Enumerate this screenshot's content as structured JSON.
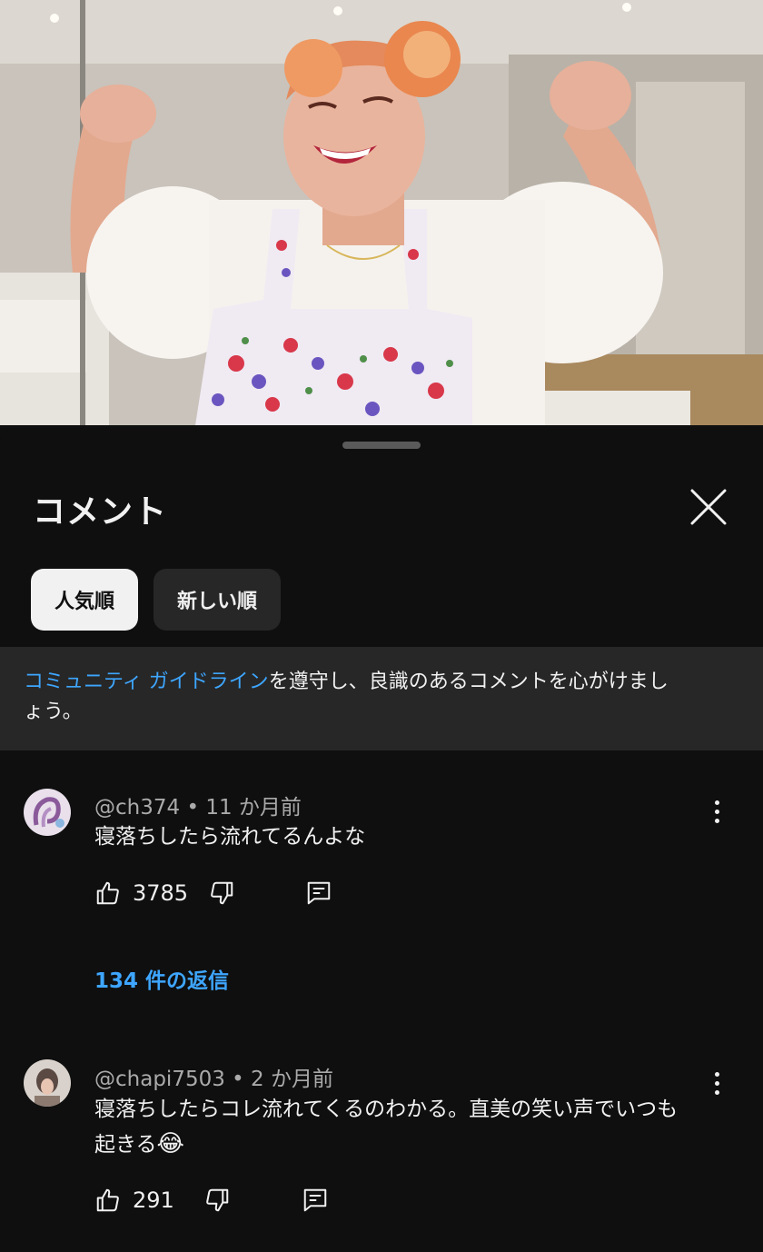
{
  "sheet": {
    "title": "コメント",
    "sort_chips": [
      {
        "label": "人気順",
        "selected": true
      },
      {
        "label": "新しい順",
        "selected": false
      }
    ],
    "notice_link": "コミュニティ ガイドライン",
    "notice_text_line1": "を遵守し、良識のあるコメントを心がけまし",
    "notice_text_line2": "ょう。"
  },
  "comments": [
    {
      "author": "@ch374",
      "time": "11 か月前",
      "text": "寝落ちしたら流れてるんよな",
      "likes": "3785",
      "replies_label": "134 件の返信"
    },
    {
      "author": "@chapi7503",
      "time": "2 か月前",
      "text_line1": "寝落ちしたらコレ流れてくるのわかる。直美の笑い声でいつも",
      "text_line2": "起きる",
      "emoji": "😂",
      "likes": "291"
    }
  ],
  "separator": "•",
  "colors": {
    "background": "#0f0f0f",
    "surface": "#272727",
    "text_primary": "#f1f1f1",
    "text_secondary": "#aaaaaa",
    "link": "#3ea6ff"
  },
  "icons": [
    "close-icon",
    "like-icon",
    "dislike-icon",
    "reply-icon",
    "more-vert-icon"
  ]
}
